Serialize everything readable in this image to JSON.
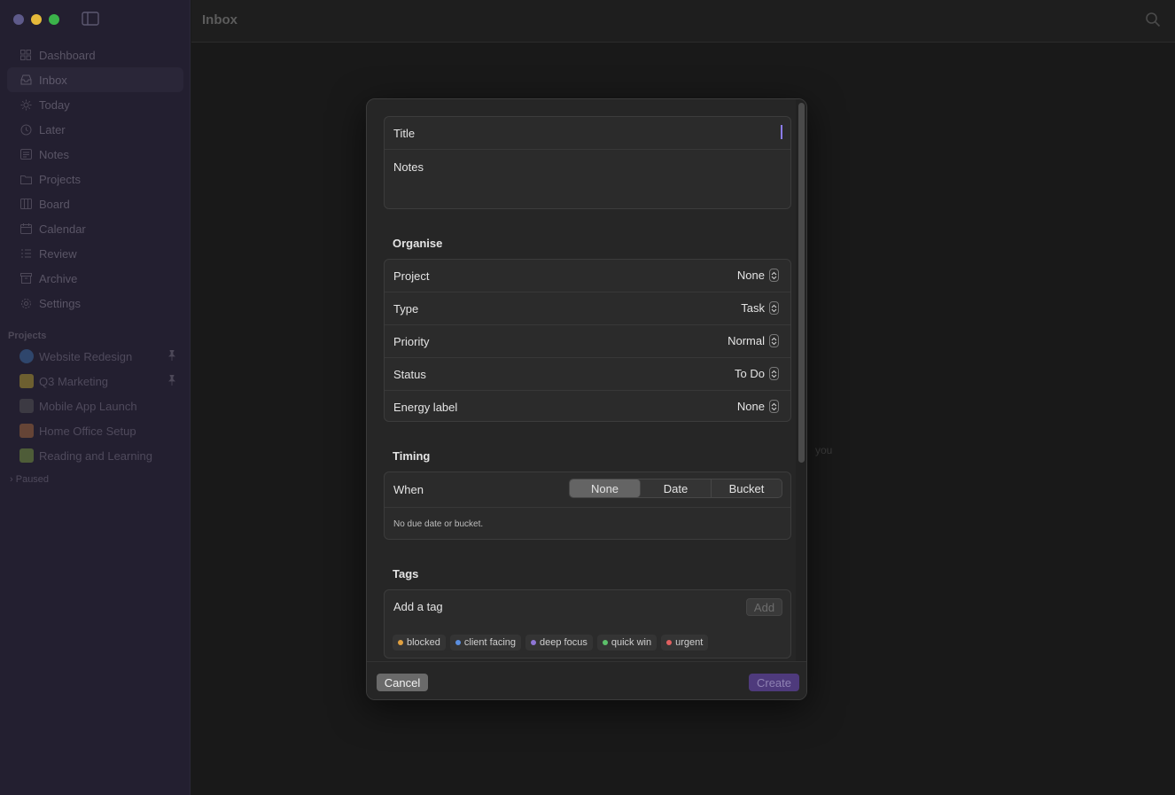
{
  "window": {
    "title": "Inbox"
  },
  "colors": {
    "accent": "#8b7cf2",
    "sidebar_bg": "#231f30",
    "create_bg": "#4e3a7c"
  },
  "traffic_lights": [
    "#5e5a8a",
    "#e5b93a",
    "#3bb34a"
  ],
  "sidebar": {
    "items": [
      {
        "label": "Dashboard",
        "icon": "dashboard-icon"
      },
      {
        "label": "Inbox",
        "icon": "inbox-icon"
      },
      {
        "label": "Today",
        "icon": "sun-icon"
      },
      {
        "label": "Later",
        "icon": "clock-icon"
      },
      {
        "label": "Notes",
        "icon": "notes-icon"
      },
      {
        "label": "Projects",
        "icon": "folder-icon"
      },
      {
        "label": "Board",
        "icon": "board-icon"
      },
      {
        "label": "Calendar",
        "icon": "calendar-icon"
      },
      {
        "label": "Review",
        "icon": "review-icon"
      },
      {
        "label": "Archive",
        "icon": "archive-icon"
      },
      {
        "label": "Settings",
        "icon": "gear-icon"
      }
    ],
    "projects_label": "Projects",
    "projects": [
      {
        "label": "Website Redesign",
        "icon": "globe-icon"
      },
      {
        "label": "Q3 Marketing",
        "icon": "megaphone-icon"
      },
      {
        "label": "Mobile App Launch",
        "icon": "phone-icon"
      },
      {
        "label": "Home Office Setup",
        "icon": "house-icon"
      },
      {
        "label": "Reading and Learning",
        "icon": "books-icon"
      }
    ],
    "paused_label": "Paused"
  },
  "background_hint": "you",
  "modal": {
    "title_label": "Title",
    "notes_label": "Notes",
    "organise": {
      "heading": "Organise",
      "rows": [
        {
          "label": "Project",
          "value": "None"
        },
        {
          "label": "Type",
          "value": "Task"
        },
        {
          "label": "Priority",
          "value": "Normal"
        },
        {
          "label": "Status",
          "value": "To Do"
        },
        {
          "label": "Energy label",
          "value": "None"
        }
      ]
    },
    "timing": {
      "heading": "Timing",
      "when_label": "When",
      "options": [
        "None",
        "Date",
        "Bucket"
      ],
      "selected": "None",
      "hint": "No due date or bucket."
    },
    "tags": {
      "heading": "Tags",
      "input_placeholder": "Add a tag",
      "add_label": "Add",
      "chips": [
        {
          "label": "blocked",
          "color": "#e0a040"
        },
        {
          "label": "client facing",
          "color": "#5b8fe0"
        },
        {
          "label": "deep focus",
          "color": "#8f76d6"
        },
        {
          "label": "quick win",
          "color": "#5cc06a"
        },
        {
          "label": "urgent",
          "color": "#e06060"
        }
      ]
    },
    "footer": {
      "cancel_label": "Cancel",
      "create_label": "Create"
    }
  }
}
